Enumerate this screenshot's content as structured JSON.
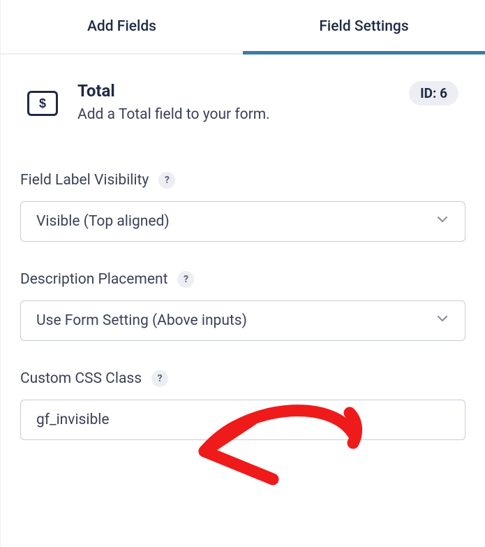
{
  "tabs": {
    "add_fields": "Add Fields",
    "field_settings": "Field Settings"
  },
  "header": {
    "title": "Total",
    "description": "Add a Total field to your form.",
    "id_badge": "ID: 6"
  },
  "settings": {
    "field_label_visibility": {
      "label": "Field Label Visibility",
      "value": "Visible (Top aligned)"
    },
    "description_placement": {
      "label": "Description Placement",
      "value": "Use Form Setting (Above inputs)"
    },
    "custom_css_class": {
      "label": "Custom CSS Class",
      "value": "gf_invisible"
    }
  },
  "help_glyph": "?"
}
